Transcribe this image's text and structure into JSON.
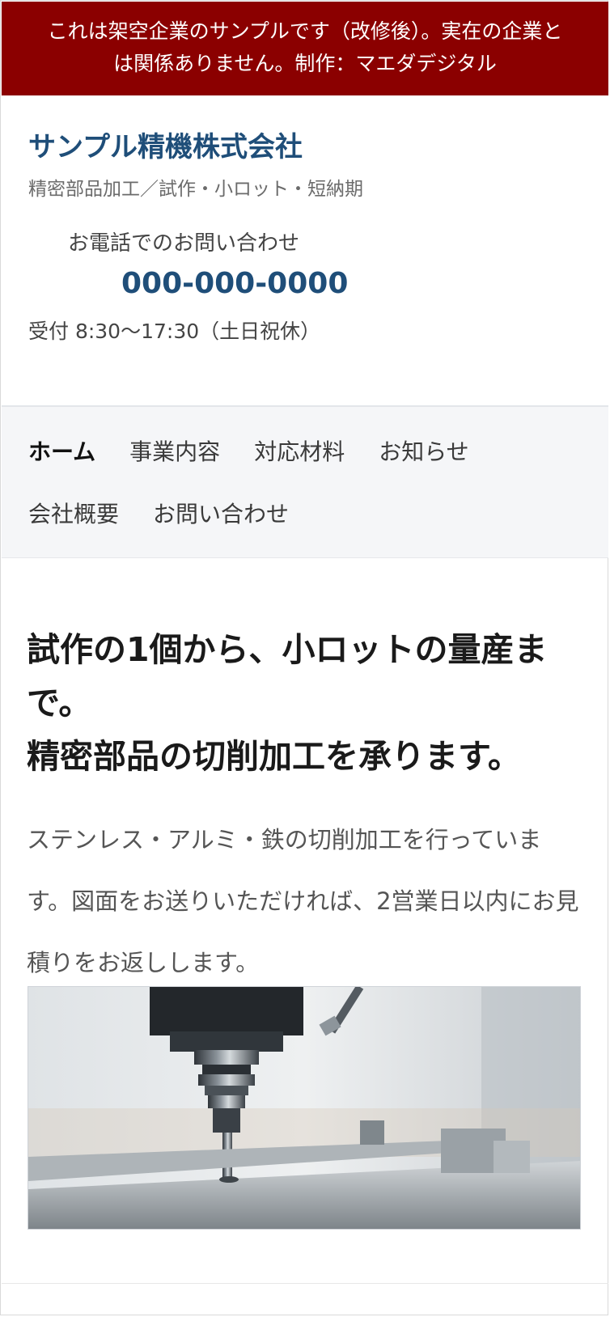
{
  "notice": {
    "line1": "これは架空企業のサンプルです（改修後）。実在の企業と",
    "line2": "は関係ありません。制作：マエダデジタル"
  },
  "header": {
    "company_name": "サンプル精機株式会社",
    "tagline": "精密部品加工／試作・小ロット・短納期",
    "tel_label": "お電話でのお問い合わせ",
    "tel_number": "000-000-0000",
    "hours": "受付 8:30〜17:30（土日祝休）"
  },
  "nav": {
    "items": [
      {
        "label": "ホーム",
        "active": true
      },
      {
        "label": "事業内容"
      },
      {
        "label": "対応材料"
      },
      {
        "label": "お知らせ"
      },
      {
        "label": "会社概要"
      },
      {
        "label": "お問い合わせ"
      }
    ]
  },
  "hero": {
    "title_line1": "試作の1個から、小ロットの量産ま",
    "title_line2": "で。",
    "title_line3": "精密部品の切削加工を承ります。",
    "description": "ステンレス・アルミ・鉄の切削加工を行っています。図面をお送りいただければ、2営業日以内にお見積りをお返しします。",
    "image_subject": "cnc-milling-machine-photo"
  },
  "colors": {
    "notice_bg": "#8b0000",
    "brand_blue": "#1f4e79",
    "nav_bg": "#f5f6f8"
  }
}
